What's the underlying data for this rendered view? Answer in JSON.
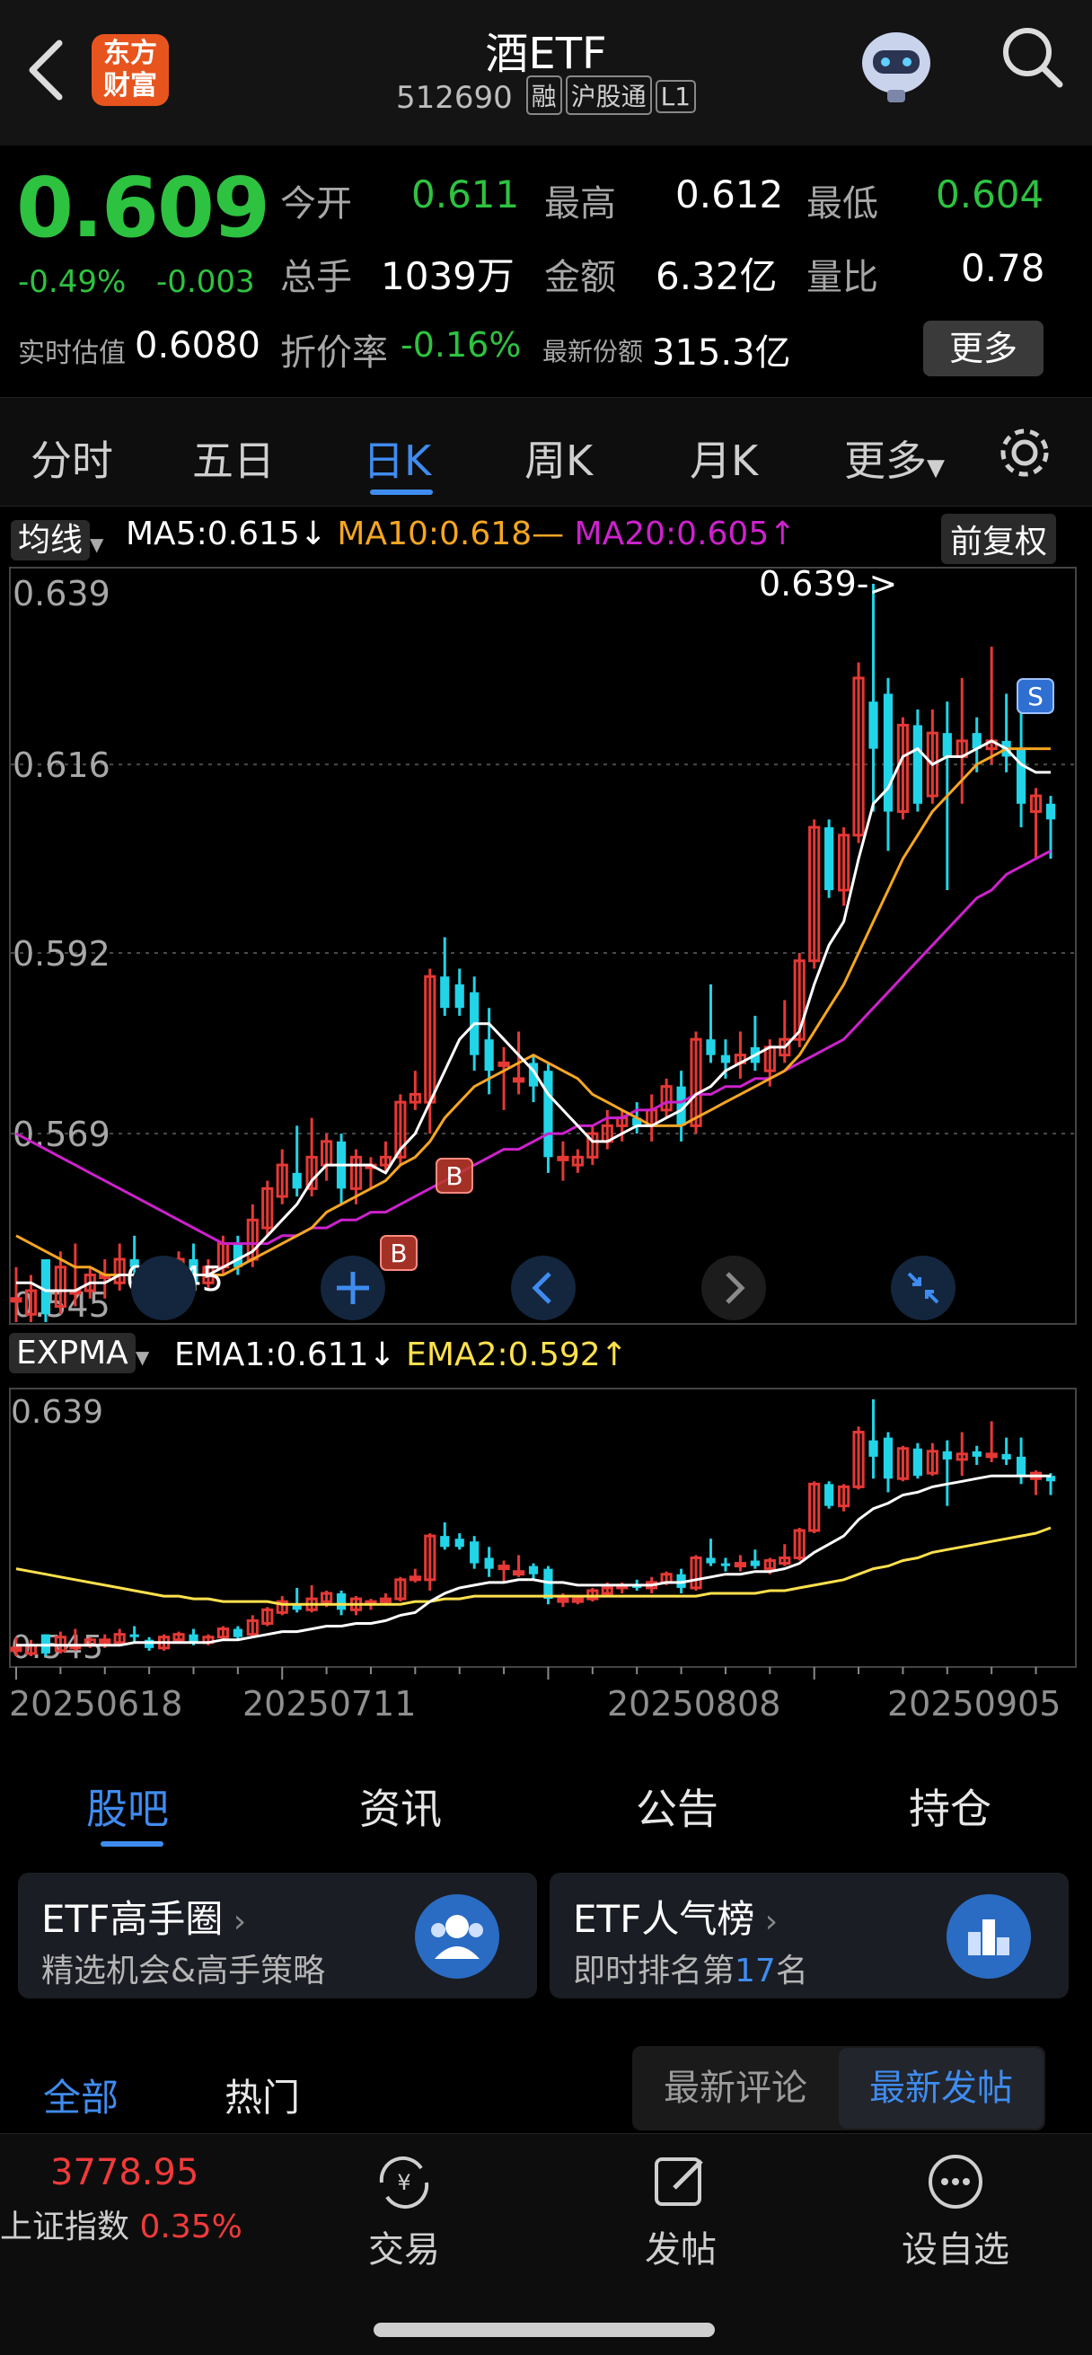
{
  "header": {
    "back_icon": "chevron-left-icon",
    "logo_text": "东方\n财富",
    "title": "酒ETF",
    "code": "512690",
    "tags": [
      "融",
      "沪股通",
      "L1"
    ],
    "robot_icon": "robot-avatar-icon",
    "search_icon": "search-icon"
  },
  "quote": {
    "price": "0.609",
    "change_pct": "-0.49%",
    "change": "-0.003",
    "open_label": "今开",
    "open": "0.611",
    "high_label": "最高",
    "high": "0.612",
    "low_label": "最低",
    "low": "0.604",
    "volume_label": "总手",
    "volume": "1039万",
    "amount_label": "金额",
    "amount": "6.32亿",
    "ratio_label": "量比",
    "ratio": "0.78",
    "iopv_label": "实时估值",
    "iopv": "0.6080",
    "discount_label": "折价率",
    "discount": "-0.16%",
    "shares_label": "最新份额",
    "shares": "315.3亿",
    "more_button": "更多"
  },
  "tabs": {
    "items": [
      "分时",
      "五日",
      "日K",
      "周K",
      "月K",
      "更多"
    ],
    "active": "日K",
    "settings_icon": "gear-icon"
  },
  "main_chart": {
    "indicator_selector": "均线",
    "ma5": "MA5:0.615",
    "ma10": "MA10:0.618",
    "ma20": "MA20:0.605",
    "ma5_arrow": "↓",
    "ma10_arrow": "—",
    "ma20_arrow": "↑",
    "adjust_button": "前复权",
    "y_labels": [
      "0.639",
      "0.616",
      "0.592",
      "0.569",
      "0.545"
    ],
    "max_marker": "0.639->",
    "min_marker": "0.545",
    "buy_signal": "B",
    "sell_signal": "S",
    "controls": [
      "plus-icon",
      "chevron-left-icon",
      "chevron-right-icon",
      "collapse-icon"
    ]
  },
  "sub_chart": {
    "indicator_selector": "EXPMA",
    "ema1": "EMA1:0.611",
    "ema1_arrow": "↓",
    "ema2": "EMA2:0.592",
    "ema2_arrow": "↑",
    "y_top": "0.639",
    "y_bottom": "0.545",
    "dates": [
      "20250618",
      "20250711",
      "20250808",
      "20250905"
    ]
  },
  "chart_data": {
    "type": "candlestick",
    "ylim": [
      0.545,
      0.639
    ],
    "candles": [
      {
        "o": 0.548,
        "c": 0.548,
        "h": 0.552,
        "l": 0.545
      },
      {
        "o": 0.546,
        "c": 0.549,
        "h": 0.551,
        "l": 0.545
      },
      {
        "o": 0.553,
        "c": 0.546,
        "h": 0.553,
        "l": 0.545
      },
      {
        "o": 0.547,
        "c": 0.552,
        "h": 0.554,
        "l": 0.546
      },
      {
        "o": 0.549,
        "c": 0.549,
        "h": 0.555,
        "l": 0.547
      },
      {
        "o": 0.549,
        "c": 0.551,
        "h": 0.552,
        "l": 0.548
      },
      {
        "o": 0.551,
        "c": 0.551,
        "h": 0.553,
        "l": 0.548
      },
      {
        "o": 0.55,
        "c": 0.553,
        "h": 0.555,
        "l": 0.549
      },
      {
        "o": 0.553,
        "c": 0.552,
        "h": 0.556,
        "l": 0.55
      },
      {
        "o": 0.551,
        "c": 0.548,
        "h": 0.552,
        "l": 0.547
      },
      {
        "o": 0.548,
        "c": 0.552,
        "h": 0.553,
        "l": 0.547
      },
      {
        "o": 0.551,
        "c": 0.553,
        "h": 0.554,
        "l": 0.55
      },
      {
        "o": 0.553,
        "c": 0.55,
        "h": 0.555,
        "l": 0.549
      },
      {
        "o": 0.55,
        "c": 0.552,
        "h": 0.553,
        "l": 0.549
      },
      {
        "o": 0.552,
        "c": 0.555,
        "h": 0.556,
        "l": 0.551
      },
      {
        "o": 0.555,
        "c": 0.552,
        "h": 0.556,
        "l": 0.551
      },
      {
        "o": 0.553,
        "c": 0.558,
        "h": 0.56,
        "l": 0.552
      },
      {
        "o": 0.557,
        "c": 0.562,
        "h": 0.563,
        "l": 0.556
      },
      {
        "o": 0.561,
        "c": 0.565,
        "h": 0.567,
        "l": 0.56
      },
      {
        "o": 0.564,
        "c": 0.562,
        "h": 0.57,
        "l": 0.561
      },
      {
        "o": 0.562,
        "c": 0.566,
        "h": 0.571,
        "l": 0.561
      },
      {
        "o": 0.565,
        "c": 0.568,
        "h": 0.569,
        "l": 0.563
      },
      {
        "o": 0.568,
        "c": 0.562,
        "h": 0.569,
        "l": 0.56
      },
      {
        "o": 0.562,
        "c": 0.566,
        "h": 0.567,
        "l": 0.56
      },
      {
        "o": 0.565,
        "c": 0.565,
        "h": 0.566,
        "l": 0.562
      },
      {
        "o": 0.565,
        "c": 0.566,
        "h": 0.568,
        "l": 0.564
      },
      {
        "o": 0.566,
        "c": 0.573,
        "h": 0.574,
        "l": 0.565
      },
      {
        "o": 0.573,
        "c": 0.574,
        "h": 0.577,
        "l": 0.572
      },
      {
        "o": 0.573,
        "c": 0.589,
        "h": 0.59,
        "l": 0.569
      },
      {
        "o": 0.589,
        "c": 0.585,
        "h": 0.594,
        "l": 0.584
      },
      {
        "o": 0.588,
        "c": 0.585,
        "h": 0.59,
        "l": 0.584
      },
      {
        "o": 0.587,
        "c": 0.579,
        "h": 0.589,
        "l": 0.577
      },
      {
        "o": 0.581,
        "c": 0.577,
        "h": 0.585,
        "l": 0.574
      },
      {
        "o": 0.578,
        "c": 0.578,
        "h": 0.58,
        "l": 0.572
      },
      {
        "o": 0.576,
        "c": 0.576,
        "h": 0.582,
        "l": 0.574
      },
      {
        "o": 0.578,
        "c": 0.575,
        "h": 0.579,
        "l": 0.573
      },
      {
        "o": 0.577,
        "c": 0.566,
        "h": 0.578,
        "l": 0.564
      },
      {
        "o": 0.566,
        "c": 0.566,
        "h": 0.568,
        "l": 0.563
      },
      {
        "o": 0.565,
        "c": 0.566,
        "h": 0.567,
        "l": 0.564
      },
      {
        "o": 0.566,
        "c": 0.569,
        "h": 0.57,
        "l": 0.565
      },
      {
        "o": 0.568,
        "c": 0.57,
        "h": 0.572,
        "l": 0.567
      },
      {
        "o": 0.57,
        "c": 0.571,
        "h": 0.572,
        "l": 0.568
      },
      {
        "o": 0.571,
        "c": 0.57,
        "h": 0.573,
        "l": 0.569
      },
      {
        "o": 0.57,
        "c": 0.572,
        "h": 0.574,
        "l": 0.568
      },
      {
        "o": 0.572,
        "c": 0.575,
        "h": 0.576,
        "l": 0.571
      },
      {
        "o": 0.575,
        "c": 0.57,
        "h": 0.577,
        "l": 0.568
      },
      {
        "o": 0.57,
        "c": 0.581,
        "h": 0.582,
        "l": 0.569
      },
      {
        "o": 0.581,
        "c": 0.579,
        "h": 0.588,
        "l": 0.578
      },
      {
        "o": 0.579,
        "c": 0.578,
        "h": 0.581,
        "l": 0.576
      },
      {
        "o": 0.578,
        "c": 0.579,
        "h": 0.582,
        "l": 0.576
      },
      {
        "o": 0.58,
        "c": 0.578,
        "h": 0.584,
        "l": 0.577
      },
      {
        "o": 0.577,
        "c": 0.58,
        "h": 0.581,
        "l": 0.575
      },
      {
        "o": 0.579,
        "c": 0.581,
        "h": 0.586,
        "l": 0.578
      },
      {
        "o": 0.581,
        "c": 0.591,
        "h": 0.592,
        "l": 0.58
      },
      {
        "o": 0.591,
        "c": 0.608,
        "h": 0.609,
        "l": 0.59
      },
      {
        "o": 0.608,
        "c": 0.6,
        "h": 0.609,
        "l": 0.599
      },
      {
        "o": 0.6,
        "c": 0.607,
        "h": 0.608,
        "l": 0.598
      },
      {
        "o": 0.607,
        "c": 0.627,
        "h": 0.629,
        "l": 0.606
      },
      {
        "o": 0.624,
        "c": 0.618,
        "h": 0.639,
        "l": 0.61
      },
      {
        "o": 0.625,
        "c": 0.61,
        "h": 0.627,
        "l": 0.605
      },
      {
        "o": 0.61,
        "c": 0.621,
        "h": 0.622,
        "l": 0.609
      },
      {
        "o": 0.621,
        "c": 0.611,
        "h": 0.623,
        "l": 0.61
      },
      {
        "o": 0.612,
        "c": 0.62,
        "h": 0.623,
        "l": 0.611
      },
      {
        "o": 0.62,
        "c": 0.617,
        "h": 0.624,
        "l": 0.6
      },
      {
        "o": 0.617,
        "c": 0.619,
        "h": 0.627,
        "l": 0.611
      },
      {
        "o": 0.62,
        "c": 0.618,
        "h": 0.622,
        "l": 0.615
      },
      {
        "o": 0.618,
        "c": 0.619,
        "h": 0.631,
        "l": 0.616
      },
      {
        "o": 0.619,
        "c": 0.617,
        "h": 0.625,
        "l": 0.615
      },
      {
        "o": 0.618,
        "c": 0.611,
        "h": 0.625,
        "l": 0.608
      },
      {
        "o": 0.61,
        "c": 0.612,
        "h": 0.613,
        "l": 0.604
      },
      {
        "o": 0.611,
        "c": 0.609,
        "h": 0.612,
        "l": 0.604
      }
    ],
    "ma5": [
      0.55,
      0.55,
      0.549,
      0.549,
      0.549,
      0.55,
      0.55,
      0.551,
      0.551,
      0.551,
      0.551,
      0.551,
      0.551,
      0.551,
      0.552,
      0.553,
      0.554,
      0.556,
      0.558,
      0.56,
      0.563,
      0.565,
      0.565,
      0.565,
      0.565,
      0.564,
      0.567,
      0.569,
      0.573,
      0.577,
      0.581,
      0.583,
      0.583,
      0.581,
      0.579,
      0.577,
      0.574,
      0.572,
      0.57,
      0.568,
      0.568,
      0.569,
      0.57,
      0.57,
      0.571,
      0.572,
      0.574,
      0.575,
      0.577,
      0.578,
      0.579,
      0.58,
      0.58,
      0.582,
      0.588,
      0.593,
      0.596,
      0.604,
      0.611,
      0.613,
      0.617,
      0.618,
      0.616,
      0.617,
      0.617,
      0.618,
      0.619,
      0.618,
      0.616,
      0.615,
      0.615
    ],
    "ma10": [
      0.556,
      0.555,
      0.554,
      0.553,
      0.552,
      0.552,
      0.551,
      0.551,
      0.551,
      0.551,
      0.551,
      0.551,
      0.551,
      0.551,
      0.551,
      0.552,
      0.553,
      0.554,
      0.555,
      0.556,
      0.557,
      0.559,
      0.56,
      0.561,
      0.562,
      0.563,
      0.565,
      0.566,
      0.568,
      0.571,
      0.573,
      0.575,
      0.576,
      0.577,
      0.578,
      0.579,
      0.578,
      0.577,
      0.576,
      0.574,
      0.573,
      0.572,
      0.571,
      0.57,
      0.57,
      0.57,
      0.571,
      0.572,
      0.573,
      0.574,
      0.575,
      0.576,
      0.577,
      0.579,
      0.582,
      0.585,
      0.588,
      0.592,
      0.596,
      0.6,
      0.604,
      0.607,
      0.61,
      0.612,
      0.614,
      0.616,
      0.617,
      0.618,
      0.618,
      0.618,
      0.618
    ],
    "ma20": [
      0.569,
      0.568,
      0.567,
      0.566,
      0.565,
      0.564,
      0.563,
      0.562,
      0.561,
      0.56,
      0.559,
      0.558,
      0.557,
      0.556,
      0.555,
      0.555,
      0.555,
      0.555,
      0.556,
      0.556,
      0.557,
      0.557,
      0.558,
      0.558,
      0.559,
      0.559,
      0.56,
      0.561,
      0.562,
      0.563,
      0.564,
      0.565,
      0.566,
      0.567,
      0.567,
      0.568,
      0.569,
      0.569,
      0.57,
      0.57,
      0.571,
      0.571,
      0.572,
      0.572,
      0.573,
      0.573,
      0.574,
      0.574,
      0.575,
      0.575,
      0.576,
      0.576,
      0.577,
      0.578,
      0.579,
      0.58,
      0.581,
      0.583,
      0.585,
      0.587,
      0.589,
      0.591,
      0.593,
      0.595,
      0.597,
      0.599,
      0.6,
      0.602,
      0.603,
      0.604,
      0.605
    ],
    "ema1": [
      0.549,
      0.549,
      0.549,
      0.549,
      0.549,
      0.549,
      0.549,
      0.549,
      0.55,
      0.55,
      0.55,
      0.55,
      0.55,
      0.55,
      0.551,
      0.551,
      0.552,
      0.553,
      0.554,
      0.554,
      0.555,
      0.556,
      0.556,
      0.557,
      0.557,
      0.558,
      0.56,
      0.561,
      0.565,
      0.568,
      0.57,
      0.571,
      0.572,
      0.572,
      0.573,
      0.573,
      0.572,
      0.572,
      0.571,
      0.571,
      0.571,
      0.571,
      0.571,
      0.571,
      0.572,
      0.572,
      0.573,
      0.574,
      0.575,
      0.575,
      0.576,
      0.576,
      0.577,
      0.579,
      0.583,
      0.586,
      0.589,
      0.595,
      0.599,
      0.601,
      0.604,
      0.605,
      0.607,
      0.608,
      0.609,
      0.61,
      0.611,
      0.611,
      0.611,
      0.611,
      0.611
    ],
    "ema2": [
      0.577,
      0.576,
      0.575,
      0.574,
      0.573,
      0.572,
      0.571,
      0.57,
      0.569,
      0.568,
      0.567,
      0.567,
      0.566,
      0.566,
      0.565,
      0.565,
      0.565,
      0.565,
      0.564,
      0.564,
      0.564,
      0.564,
      0.564,
      0.564,
      0.564,
      0.564,
      0.564,
      0.565,
      0.565,
      0.566,
      0.566,
      0.567,
      0.567,
      0.567,
      0.567,
      0.567,
      0.567,
      0.567,
      0.567,
      0.567,
      0.567,
      0.567,
      0.567,
      0.567,
      0.567,
      0.567,
      0.567,
      0.568,
      0.568,
      0.568,
      0.568,
      0.569,
      0.569,
      0.57,
      0.571,
      0.572,
      0.573,
      0.575,
      0.577,
      0.578,
      0.58,
      0.581,
      0.583,
      0.584,
      0.585,
      0.586,
      0.587,
      0.588,
      0.589,
      0.59,
      0.592
    ],
    "colors": {
      "up": "#e53935",
      "down": "#21d4e8",
      "ma5": "#ffffff",
      "ma10": "#f5a623",
      "ma20": "#cc22cc",
      "ema1": "#ffffff",
      "ema2": "#ffe14d"
    }
  },
  "community": {
    "tabs": [
      "股吧",
      "资讯",
      "公告",
      "持仓"
    ],
    "active": "股吧",
    "card1_title": "ETF高手圈",
    "card1_sub": "精选机会&高手策略",
    "card2_title": "ETF人气榜",
    "card2_sub_prefix": "即时排名第",
    "card2_rank": "17",
    "card2_sub_suffix": "名",
    "filters": [
      "全部",
      "热门"
    ],
    "sort": [
      "最新评论",
      "最新发帖"
    ]
  },
  "bottom_nav": {
    "index_value": "3778.95",
    "index_name": "上证指数",
    "index_change": "0.35%",
    "trade": "交易",
    "post": "发帖",
    "watch": "设自选"
  }
}
